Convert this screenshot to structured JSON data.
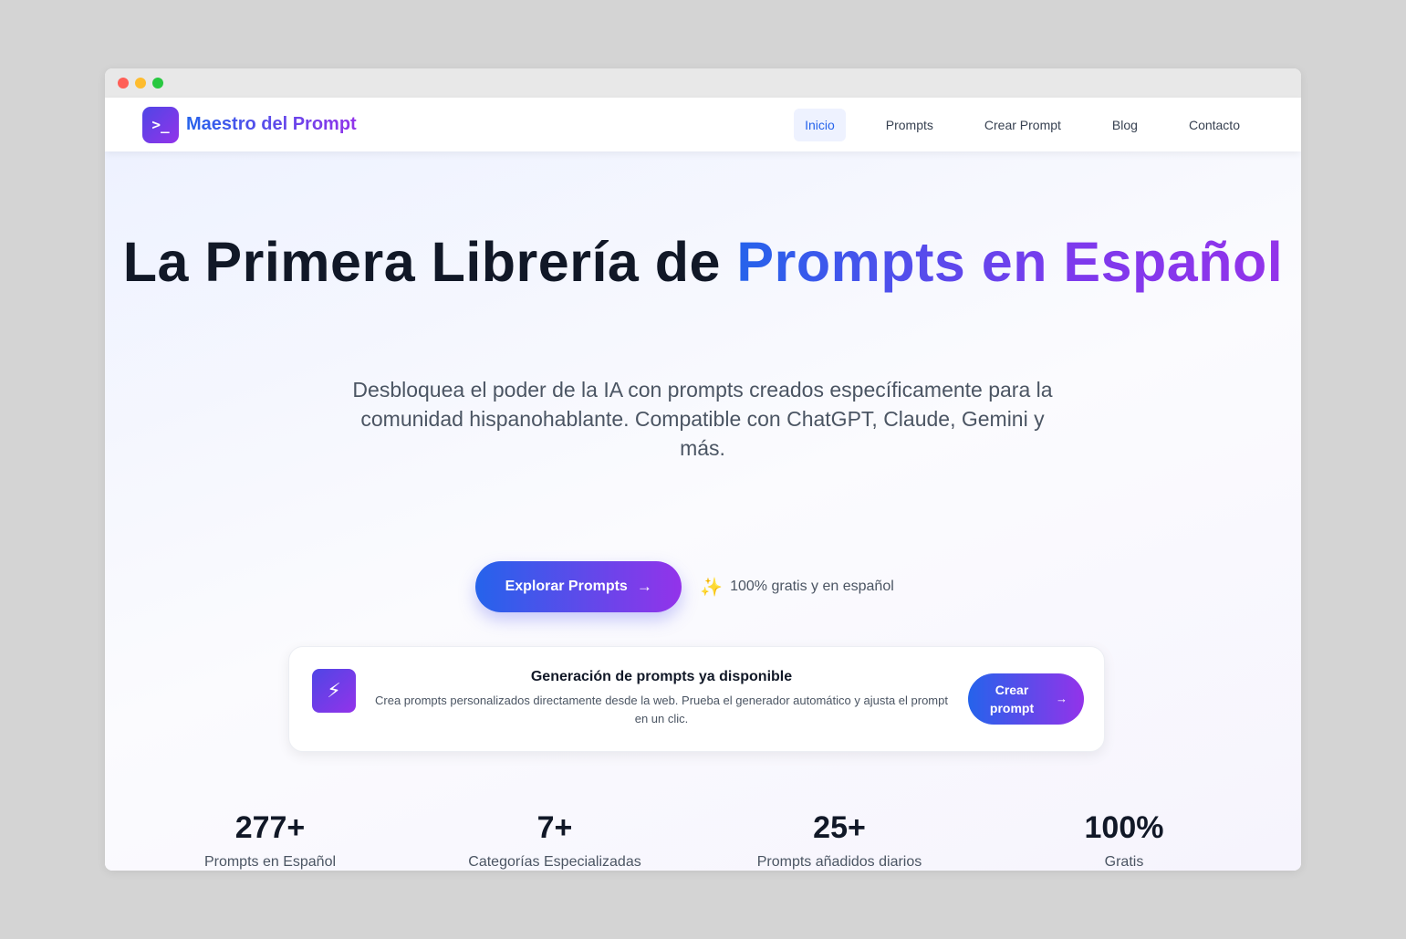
{
  "nav": {
    "brand": "Maestro del Prompt",
    "logo_glyph": ">_",
    "links": [
      {
        "label": "Inicio",
        "active": true
      },
      {
        "label": "Prompts",
        "active": false
      },
      {
        "label": "Crear Prompt",
        "active": false
      },
      {
        "label": "Blog",
        "active": false
      },
      {
        "label": "Contacto",
        "active": false
      }
    ]
  },
  "hero": {
    "title_plain": "La Primera Librería de ",
    "title_highlight": "Prompts en Español",
    "subtitle": "Desbloquea el poder de la IA con prompts creados específicamente para la comunidad hispanohablante. Compatible con ChatGPT, Claude, Gemini y más.",
    "cta_label": "Explorar Prompts",
    "cta_arrow": "→",
    "note_icon": "✨",
    "free_note": "100% gratis y en español"
  },
  "promo": {
    "icon": "⚡",
    "title": "Generación de prompts ya disponible",
    "description": "Crea prompts personalizados directamente desde la web. Prueba el generador automático y ajusta el prompt en un clic.",
    "button_label": "Crear prompt",
    "button_arrow": "→"
  },
  "stats": [
    {
      "value": "277+",
      "label": "Prompts en Español"
    },
    {
      "value": "7+",
      "label": "Categorías Especializadas"
    },
    {
      "value": "25+",
      "label": "Prompts añadidos diarios"
    },
    {
      "value": "100%",
      "label": "Gratis"
    }
  ],
  "colors": {
    "accent_start": "#2563eb",
    "accent_end": "#9333ea",
    "active_nav_bg": "#eef2ff"
  }
}
